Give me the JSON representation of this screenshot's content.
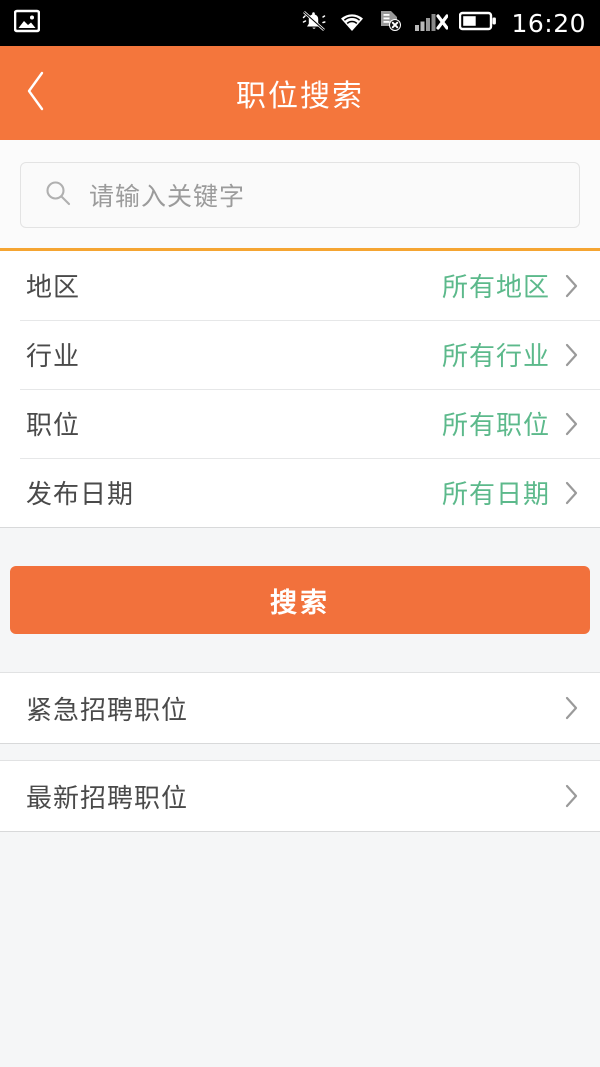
{
  "statusbar": {
    "time": "16:20",
    "icons": {
      "photo": "photo-icon",
      "vibrate_mute": "bell-mute-icon",
      "wifi": "wifi-icon",
      "sim_error": "sim-card-error-icon",
      "signal_none": "signal-bars-no-service-icon",
      "battery": "battery-half-icon"
    }
  },
  "header": {
    "title": "职位搜索",
    "back_icon": "chevron-left-icon",
    "background": "#f4763c"
  },
  "search": {
    "placeholder": "请输入关键字",
    "value": "",
    "icon": "search-icon",
    "accent_line": "#f5a532"
  },
  "filters": {
    "rows": [
      {
        "label": "地区",
        "value": "所有地区"
      },
      {
        "label": "行业",
        "value": "所有行业"
      },
      {
        "label": "职位",
        "value": "所有职位"
      },
      {
        "label": "发布日期",
        "value": "所有日期"
      }
    ],
    "value_color": "#5cb98b",
    "chevron_icon": "chevron-right-icon"
  },
  "actions": {
    "search_button": "搜索",
    "search_button_color": "#f2713c"
  },
  "links": [
    {
      "label": "紧急招聘职位",
      "chevron_icon": "chevron-right-icon"
    },
    {
      "label": "最新招聘职位",
      "chevron_icon": "chevron-right-icon"
    }
  ]
}
